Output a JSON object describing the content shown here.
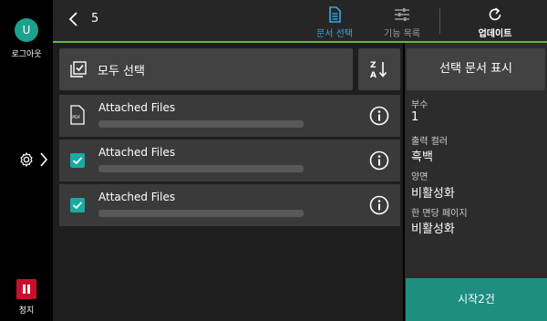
{
  "rail": {
    "avatar_letter": "U",
    "logout_label": "로그아웃",
    "stop_label": "정지"
  },
  "header": {
    "count": "5",
    "tab_select_docs": "문서 선택",
    "tab_function_list": "기능 목록",
    "update_label": "업데이트"
  },
  "toolbar": {
    "select_all_label": "모두 선택"
  },
  "items": [
    {
      "title": "Attached Files",
      "selected": false,
      "type": "pdf"
    },
    {
      "title": "Attached Files",
      "selected": true,
      "type": "checked"
    },
    {
      "title": "Attached Files",
      "selected": true,
      "type": "checked"
    }
  ],
  "right_panel": {
    "show_selected_label": "선택 문서 표시",
    "properties": [
      {
        "key": "부수",
        "value": "1"
      },
      {
        "key": "출력 컬러",
        "value": "흑백"
      },
      {
        "key": "양면",
        "value": "비활성화"
      },
      {
        "key": "한 면당 페이지",
        "value": "비활성화"
      }
    ],
    "start_label": "시작2건"
  },
  "colors": {
    "accent_blue": "#36a9e1",
    "teal": "#19aba0",
    "start_green": "#1d8e80",
    "header_line": "#6fb33f",
    "stop_red": "#c8102e"
  }
}
